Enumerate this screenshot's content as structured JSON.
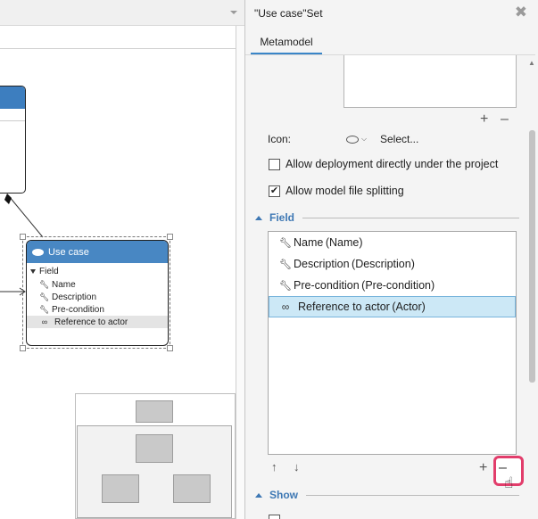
{
  "canvas": {
    "node": {
      "title": "Use case",
      "section": "Field",
      "fields": [
        {
          "icon": "wrench-icon",
          "label": "Name"
        },
        {
          "icon": "wrench-icon",
          "label": "Description"
        },
        {
          "icon": "wrench-icon",
          "label": "Pre-condition"
        },
        {
          "icon": "link-icon",
          "label": "Reference to actor",
          "selected": true
        }
      ]
    }
  },
  "panel": {
    "title": "\"Use case\"Set",
    "close_icon": "close-icon",
    "tabs": [
      {
        "label": "Metamodel",
        "active": true
      }
    ],
    "icon_label": "Icon:",
    "icon_select": "Select...",
    "checkboxes": [
      {
        "label": "Allow deployment directly under the project",
        "checked": false
      },
      {
        "label": "Allow model file splitting",
        "checked": true
      }
    ],
    "field_section": {
      "title": "Field",
      "items": [
        {
          "icon": "wrench-icon",
          "label": "Name (Name)"
        },
        {
          "icon": "wrench-icon",
          "label": "Description (Description)"
        },
        {
          "icon": "wrench-icon",
          "label": "Pre-condition (Pre-condition)"
        },
        {
          "icon": "link-icon",
          "label": "Reference to actor (Actor)",
          "selected": true
        }
      ]
    },
    "show_section": {
      "title": "Show"
    },
    "buttons": {
      "add": "+",
      "remove": "–",
      "up": "↑",
      "down": "↓"
    }
  },
  "colors": {
    "accent": "#3e78b4",
    "node_header": "#4887c3",
    "selection": "#cce8f6",
    "highlight": "#e23d6b"
  }
}
